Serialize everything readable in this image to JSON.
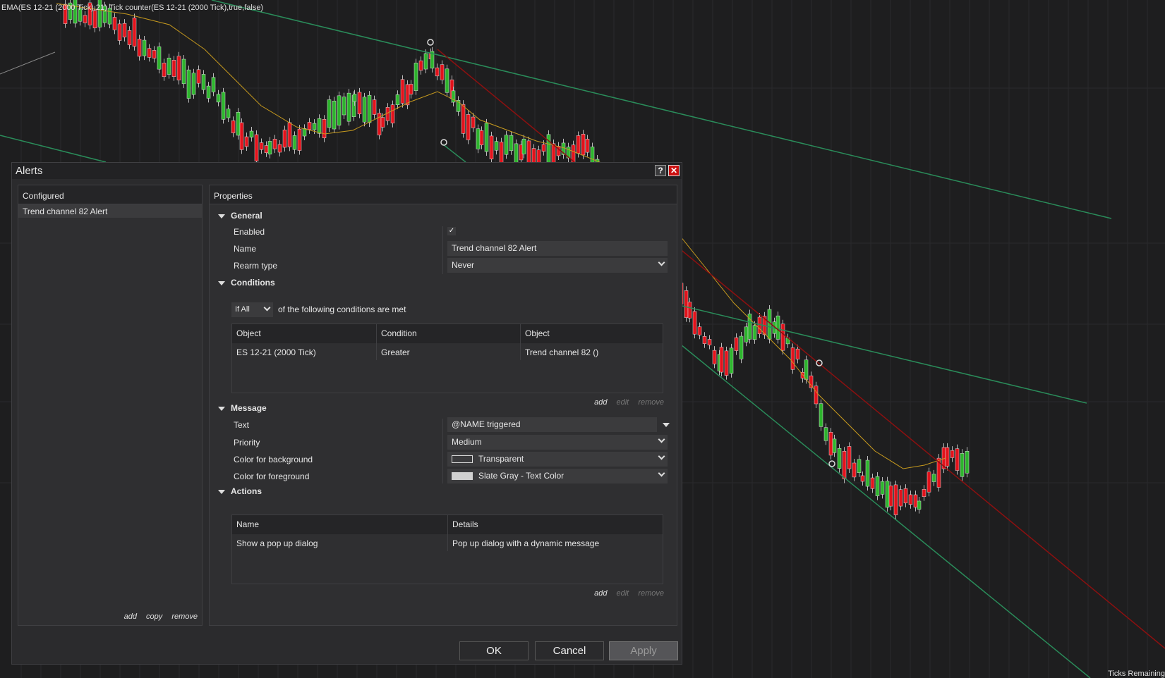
{
  "chart": {
    "indicator_title": "EMA(ES 12-21 (2000 Tick),21) Tick counter(ES 12-21 (2000 Tick),true,false)",
    "ticks_remaining": "Ticks Remaining",
    "colors": {
      "background": "#1e1e1f",
      "up_candle": "#2db52d",
      "down_candle": "#e3121b",
      "ema": "#c79a1e",
      "trend_green": "#2a8c5a",
      "trend_red": "#8c1010"
    }
  },
  "dialog": {
    "title": "Alerts",
    "help_label": "?",
    "close_label": "✕",
    "configured": {
      "header": "Configured",
      "items": [
        "Trend channel 82 Alert"
      ],
      "links": {
        "add": "add",
        "copy": "copy",
        "remove": "remove"
      }
    },
    "properties": {
      "header": "Properties",
      "general": {
        "section_label": "General",
        "enabled_label": "Enabled",
        "enabled_value": "✓",
        "name_label": "Name",
        "name_value": "Trend channel 82 Alert",
        "rearm_label": "Rearm type",
        "rearm_value": "Never"
      },
      "conditions": {
        "section_label": "Conditions",
        "mode_value": "If All",
        "mode_text": "of the following conditions are met",
        "columns": [
          "Object",
          "Condition",
          "Object"
        ],
        "rows": [
          [
            "ES 12-21 (2000 Tick)",
            "Greater",
            "Trend channel 82 ()"
          ]
        ],
        "links": {
          "add": "add",
          "edit": "edit",
          "remove": "remove"
        }
      },
      "message": {
        "section_label": "Message",
        "text_label": "Text",
        "text_value": "@NAME triggered",
        "priority_label": "Priority",
        "priority_value": "Medium",
        "bg_label": "Color for background",
        "bg_value": "Transparent",
        "fg_label": "Color for foreground",
        "fg_value": "Slate Gray - Text Color"
      },
      "actions": {
        "section_label": "Actions",
        "columns": [
          "Name",
          "Details"
        ],
        "rows": [
          [
            "Show a pop up dialog",
            "Pop up dialog with a dynamic message"
          ]
        ],
        "links": {
          "add": "add",
          "edit": "edit",
          "remove": "remove"
        }
      }
    },
    "buttons": {
      "ok": "OK",
      "cancel": "Cancel",
      "apply": "Apply"
    }
  }
}
